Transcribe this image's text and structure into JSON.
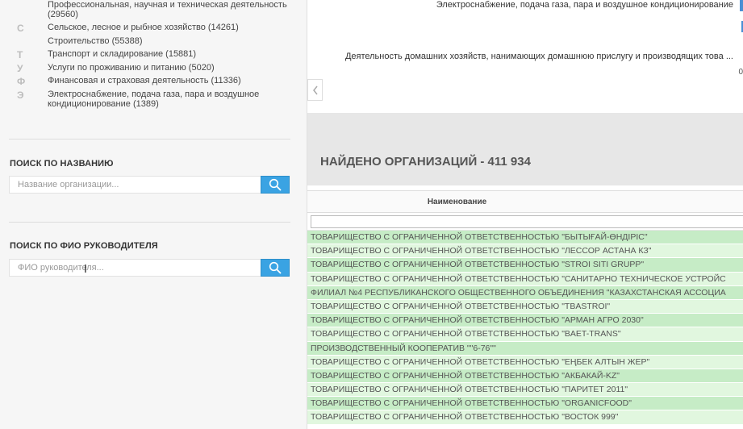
{
  "sidebar": {
    "categories": [
      {
        "letter": "",
        "label": "Профессиональная, научная и техническая деятельность (29560)"
      },
      {
        "letter": "С",
        "label": "Сельское, лесное и рыбное хозяйство (14261)"
      },
      {
        "letter": "",
        "label": "Строительство (55388)"
      },
      {
        "letter": "Т",
        "label": "Транспорт и складирование (15881)"
      },
      {
        "letter": "У",
        "label": "Услуги по проживанию и питанию (5020)"
      },
      {
        "letter": "Ф",
        "label": "Финансовая и страховая деятельность (11336)"
      },
      {
        "letter": "Э",
        "label": "Электроснабжение, подача газа, пара и воздушное кондиционирование (1389)"
      }
    ],
    "search_name": {
      "title": "ПОИСК ПО НАЗВАНИЮ",
      "placeholder": "Название организации..."
    },
    "search_head": {
      "title": "ПОИСК ПО ФИО РУКОВОДИТЕЛЯ",
      "placeholder": "ФИО руководителя..."
    }
  },
  "chart": {
    "label_1": "Электроснабжение, подача газа, пара и воздушное  кондиционирование",
    "label_2": "Деятельность домашних хозяйств, нанимающих домашнюю прислугу и производящих това ...",
    "axis_fragment": "0",
    "bar_color": "#4a8fd4"
  },
  "results": {
    "title": "НАЙДЕНО ОРГАНИЗАЦИЙ - 411 934",
    "column_header": "Наименование",
    "rows": [
      "ТОВАРИЩЕСТВО С ОГРАНИЧЕННОЙ ОТВЕТСТВЕННОСТЬЮ \"БЫТЫҒАЙ-ӨНДІРІС\"",
      "ТОВАРИЩЕСТВО С ОГРАНИЧЕННОЙ ОТВЕТСТВЕННОСТЬЮ \"ЛЕССОР АСТАНА КЗ\"",
      "ТОВАРИЩЕСТВО С ОГРАНИЧЕННОЙ ОТВЕТСТВЕННОСТЬЮ \"STROI SITI GRUPP\"",
      "ТОВАРИЩЕСТВО С ОГРАНИЧЕННОЙ ОТВЕТСТВЕННОСТЬЮ \"САНИТАРНО ТЕХНИЧЕСКОЕ УСТРОЙС",
      "ФИЛИАЛ №4 РЕСПУБЛИКАНСКОГО ОБЩЕСТВЕННОГО ОБЪЕДИНЕНИЯ \"КАЗАХСТАНСКАЯ АССОЦИА",
      "ТОВАРИЩЕСТВО С ОГРАНИЧЕННОЙ ОТВЕТСТВЕННОСТЬЮ \"TBASTROI\"",
      "ТОВАРИЩЕСТВО С ОГРАНИЧЕННОЙ ОТВЕТСТВЕННОСТЬЮ \"АРМАН АГРО 2030\"",
      "ТОВАРИЩЕСТВО С ОГРАНИЧЕННОЙ ОТВЕТСТВЕННОСТЬЮ \"BAET-TRANS\"",
      "ПРОИЗВОДСТВЕННЫЙ КООПЕРАТИВ \"\"6-76\"\"",
      "ТОВАРИЩЕСТВО С ОГРАНИЧЕННОЙ ОТВЕТСТВЕННОСТЬЮ \"ЕҢБЕК АЛТЫН ЖЕР\"",
      "ТОВАРИЩЕСТВО С ОГРАНИЧЕННОЙ ОТВЕТСТВЕННОСТЬЮ \"АКБАКАЙ-KZ\"",
      "ТОВАРИЩЕСТВО С ОГРАНИЧЕННОЙ ОТВЕТСТВЕННОСТЬЮ \"ПАРИТЕТ 2011\"",
      "ТОВАРИЩЕСТВО С ОГРАНИЧЕННОЙ ОТВЕТСТВЕННОСТЬЮ \"ORGANICFOOD\"",
      "ТОВАРИЩЕСТВО С ОГРАНИЧЕННОЙ ОТВЕТСТВЕННОСТЬЮ \"ВОСТОК 999\""
    ]
  },
  "colors": {
    "accent": "#3aa3e3",
    "row_odd": "#c6ecc6",
    "row_even": "#e1f7df"
  }
}
